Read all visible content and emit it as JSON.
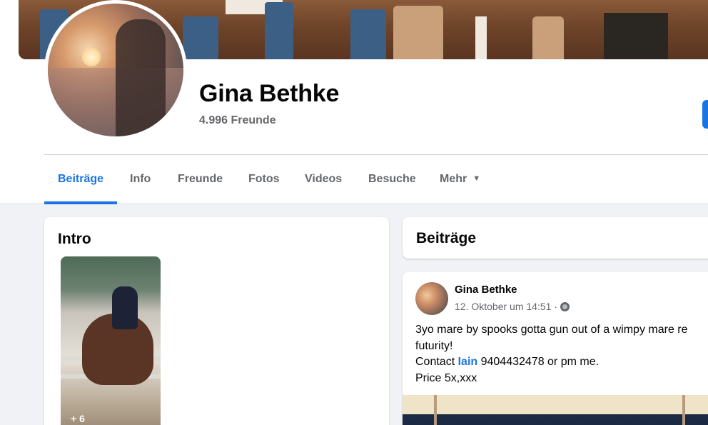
{
  "profile": {
    "name": "Gina Bethke",
    "friends_count": "4.996 Freunde"
  },
  "tabs": [
    {
      "label": "Beiträge",
      "active": true
    },
    {
      "label": "Info"
    },
    {
      "label": "Freunde"
    },
    {
      "label": "Fotos"
    },
    {
      "label": "Videos"
    },
    {
      "label": "Besuche"
    },
    {
      "label": "Mehr",
      "icon": "caret-down-icon"
    }
  ],
  "intro": {
    "title": "Intro",
    "photo_more_count": "+ 6"
  },
  "posts": {
    "header_title": "Beiträge",
    "items": [
      {
        "author": "Gina Bethke",
        "timestamp": "12. Oktober um 14:51 ·",
        "audience_icon": "globe-icon",
        "text_line1": "3yo mare by spooks gotta gun out of a wimpy mare re",
        "text_line2": "futurity!",
        "contact_prefix": "Contact ",
        "contact_link": "Iain",
        "contact_suffix": " 9404432478 or pm me.",
        "price": "Price 5x,xxx"
      }
    ]
  },
  "colors": {
    "accent": "#1b74e4",
    "secondary_text": "#65676b",
    "background": "#f0f2f5"
  }
}
